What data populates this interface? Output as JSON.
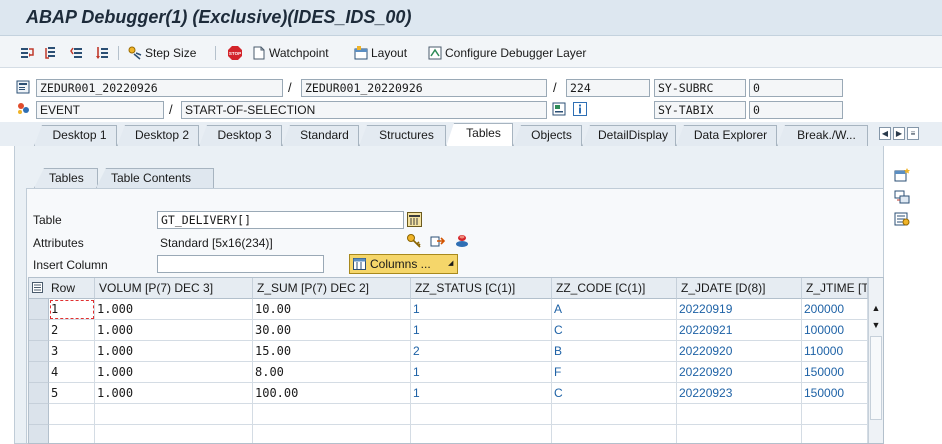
{
  "window": {
    "title": "ABAP Debugger(1)  (Exclusive)(IDES_IDS_00)"
  },
  "toolbar": {
    "icons": [
      "step-into-icon",
      "execute-icon",
      "return-icon",
      "continue-icon"
    ],
    "step_size": "Step Size",
    "watchpoint": "Watchpoint",
    "layout": "Layout",
    "configure": "Configure Debugger Layer"
  },
  "info": {
    "program": "ZEDUR001_20220926",
    "include": "ZEDUR001_20220926",
    "line": "224",
    "event_type": "EVENT",
    "event_name": "START-OF-SELECTION",
    "subrc_label": "SY-SUBRC",
    "subrc_value": "0",
    "tabix_label": "SY-TABIX",
    "tabix_value": "0",
    "slash": "/"
  },
  "main_tabs": [
    "Desktop 1",
    "Desktop 2",
    "Desktop 3",
    "Standard",
    "Structures",
    "Tables",
    "Objects",
    "DetailDisplay",
    "Data Explorer",
    "Break./W..."
  ],
  "main_tabs_active": "Tables",
  "sub_tabs": [
    "Tables",
    "Table Contents"
  ],
  "sub_tabs_active": "Table Contents",
  "form": {
    "table_label": "Table",
    "table_value": "GT_DELIVERY[]",
    "attributes_label": "Attributes",
    "attributes_value": "Standard [5x16(234)]",
    "insert_column_label": "Insert Column",
    "insert_column_value": "",
    "columns_button": "Columns ..."
  },
  "grid": {
    "headers": [
      "Row",
      "VOLUM [P(7) DEC 3]",
      "Z_SUM [P(7) DEC 2]",
      "ZZ_STATUS [C(1)]",
      "ZZ_CODE [C(1)]",
      "Z_JDATE [D(8)]",
      "Z_JTIME [T"
    ],
    "rows": [
      [
        "1",
        "1.000",
        "10.00",
        "1",
        "A",
        "20220919",
        "200000"
      ],
      [
        "2",
        "1.000",
        "30.00",
        "1",
        "C",
        "20220921",
        "100000"
      ],
      [
        "3",
        "1.000",
        "15.00",
        "2",
        "B",
        "20220920",
        "110000"
      ],
      [
        "4",
        "1.000",
        "8.00",
        "1",
        "F",
        "20220920",
        "150000"
      ],
      [
        "5",
        "1.000",
        "100.00",
        "1",
        "C",
        "20220923",
        "150000"
      ]
    ]
  },
  "colors": {
    "accent_blue": "#1e62a6",
    "stop_red": "#d3242a",
    "selection_red": "#e03030"
  }
}
